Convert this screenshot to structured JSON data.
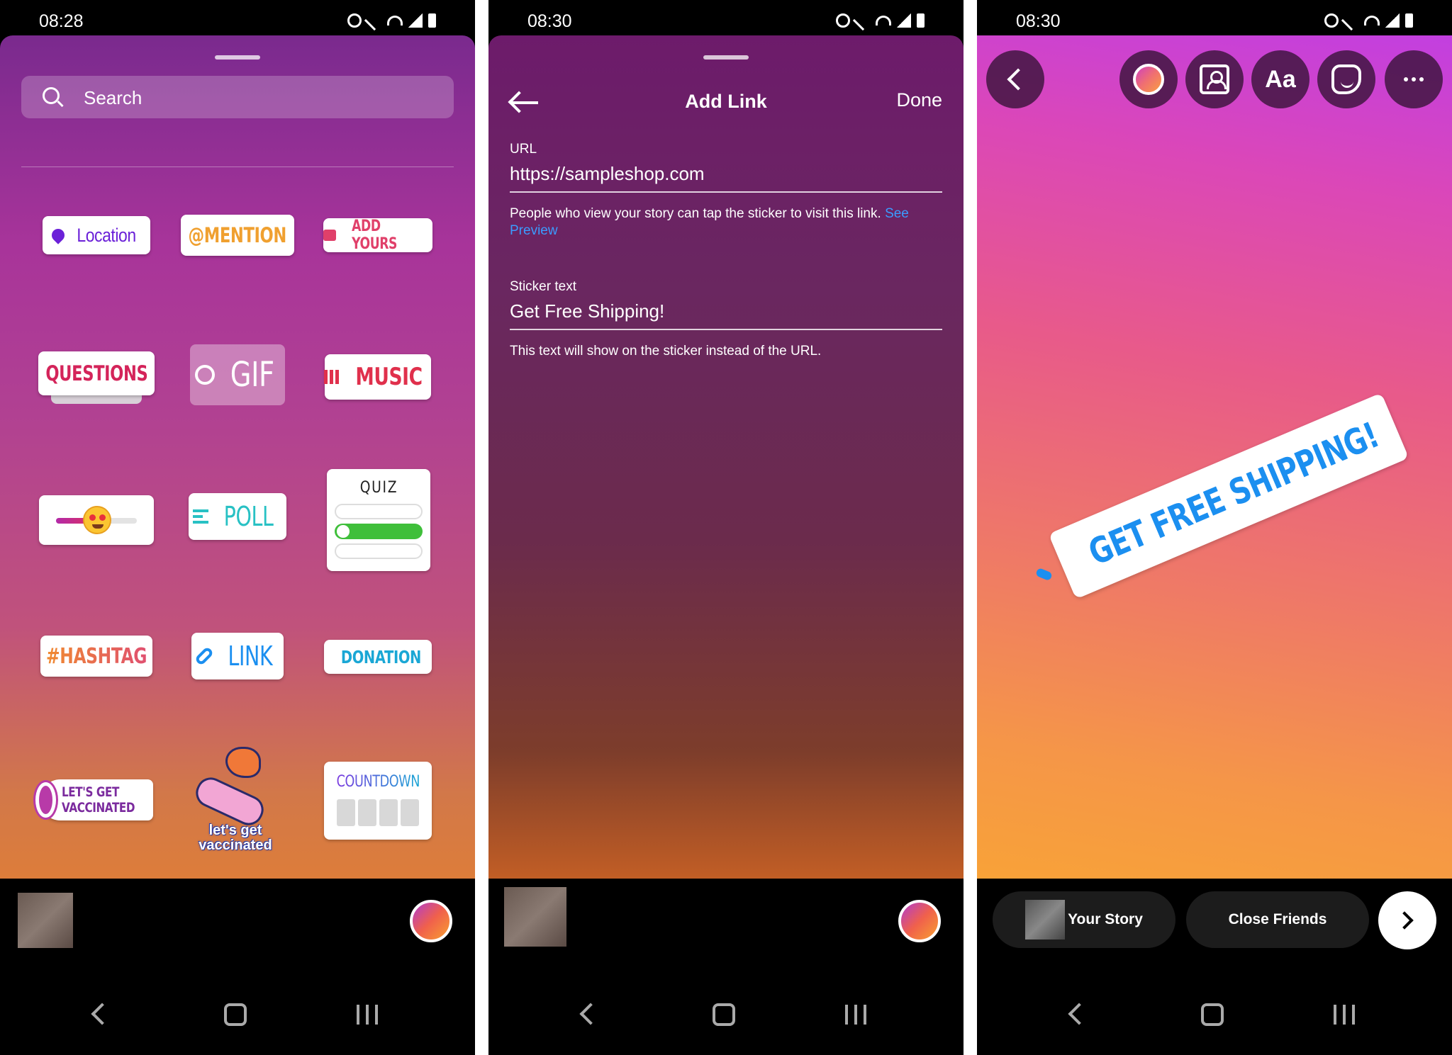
{
  "panel1": {
    "time": "08:28",
    "search_placeholder": "Search",
    "stickers": {
      "location": "Location",
      "mention": "@MENTION",
      "add_yours": "ADD YOURS",
      "questions": "QUESTIONS",
      "gif": "GIF",
      "music": "MUSIC",
      "poll": "POLL",
      "quiz": "QUIZ",
      "hashtag": "#HASHTAG",
      "link": "LINK",
      "donation": "DONATION",
      "lets_get_vaccinated_line1": "LET'S GET",
      "lets_get_vaccinated_line2": "VACCINATED",
      "vaccinated_art_line1": "let's get",
      "vaccinated_art_line2": "vaccinated",
      "countdown": "COUNTDOWN"
    }
  },
  "panel2": {
    "time": "08:30",
    "title": "Add Link",
    "done_label": "Done",
    "url_label": "URL",
    "url_value": "https://sampleshop.com",
    "url_help": "People who view your story can tap the sticker to visit this link.",
    "see_preview": "See Preview",
    "sticker_text_label": "Sticker text",
    "sticker_text_value": "Get Free Shipping!",
    "sticker_text_help": "This text will show on the sticker instead of the URL."
  },
  "panel3": {
    "time": "08:30",
    "text_tool_label": "Aa",
    "sticker_text": "GET FREE SHIPPING!",
    "your_story_label": "Your Story",
    "close_friends_label": "Close Friends"
  },
  "colors": {
    "instagram_blue": "#1b8ff0",
    "link_text": "#3b9cff"
  }
}
